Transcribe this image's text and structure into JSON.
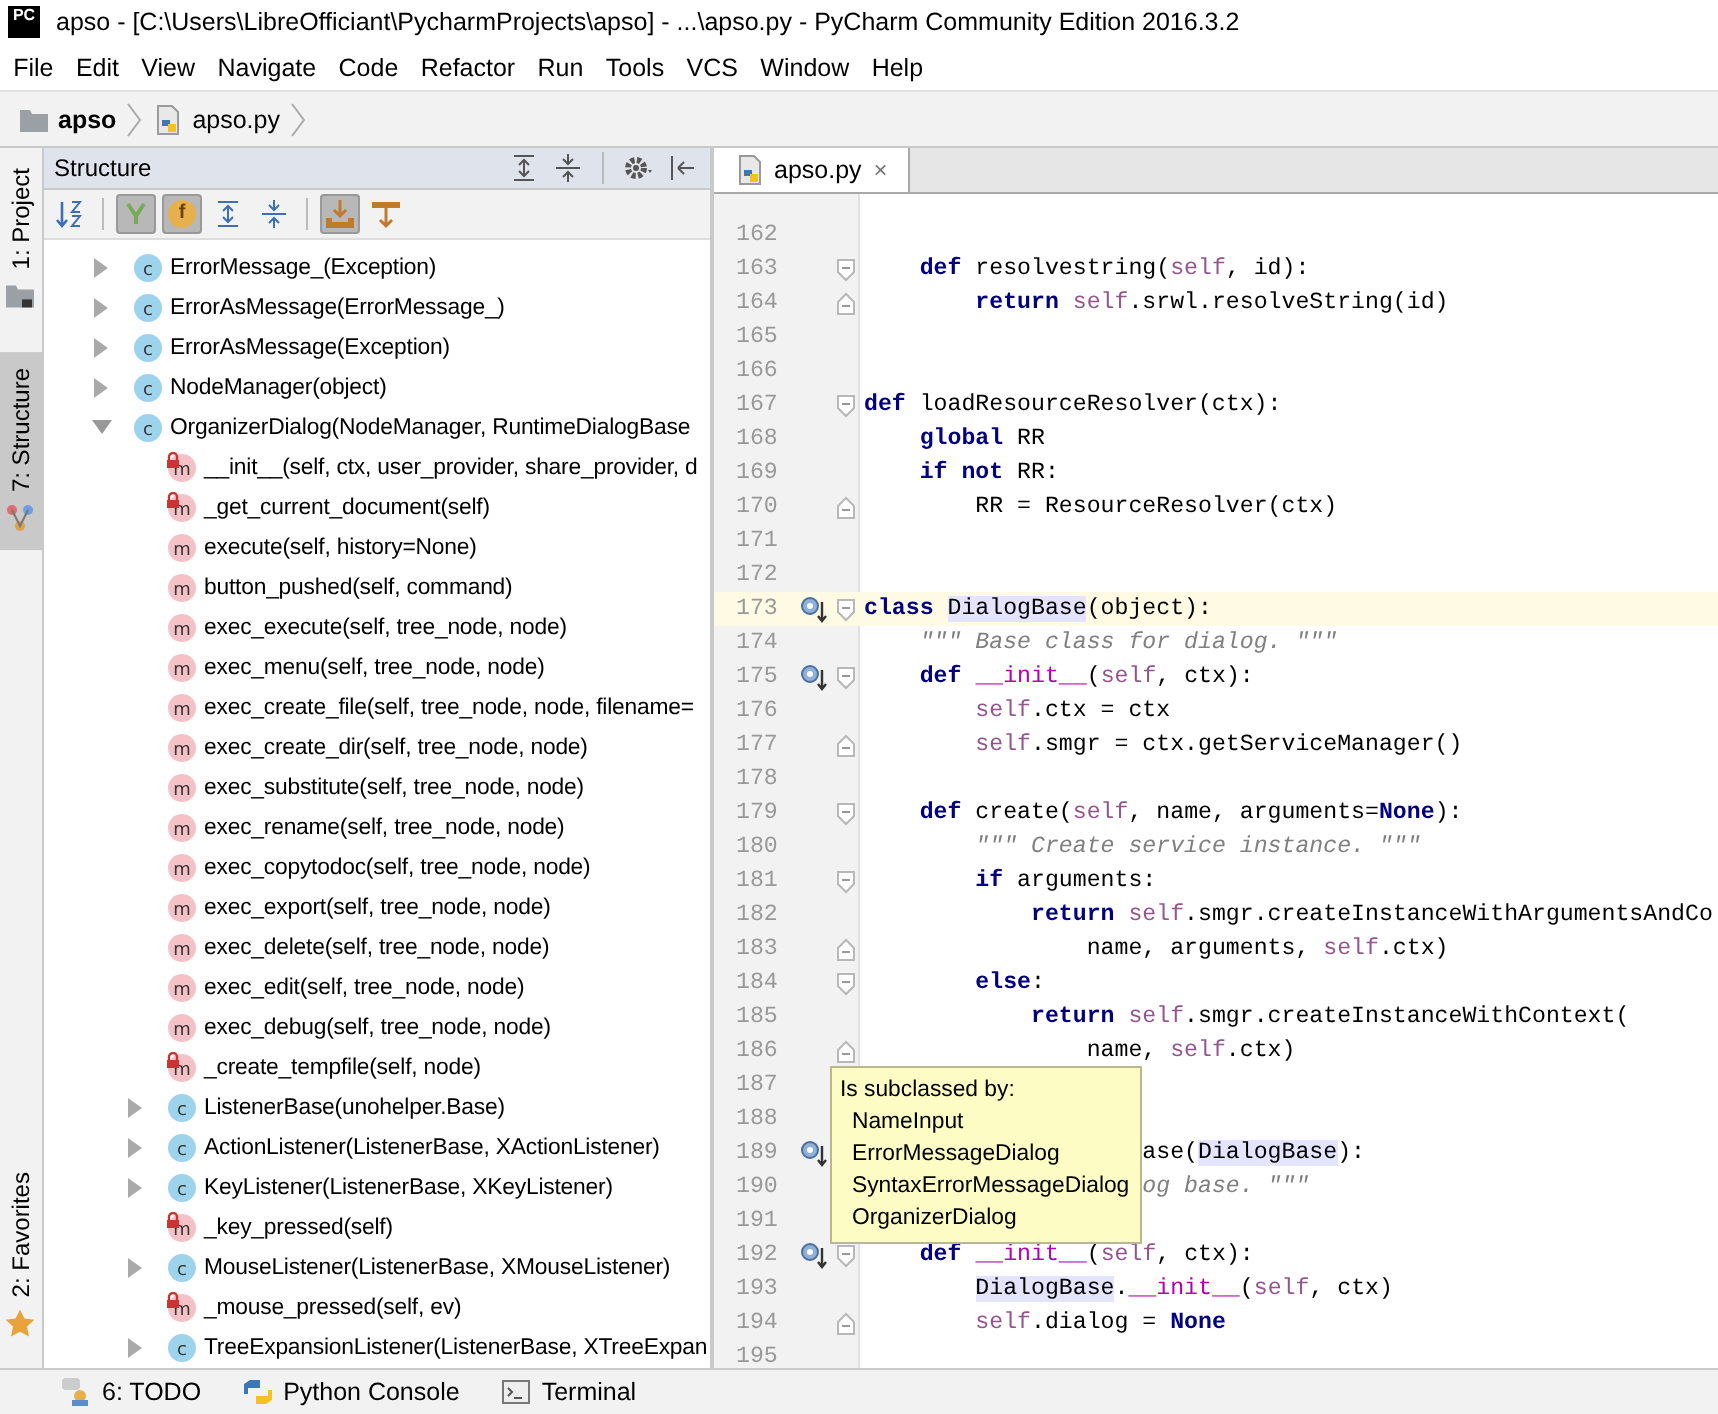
{
  "window": {
    "logo": "PC",
    "title": "apso - [C:\\Users\\LibreOfficiant\\PycharmProjects\\apso] - ...\\apso.py - PyCharm Community Edition 2016.3.2"
  },
  "menu": [
    {
      "label": "File"
    },
    {
      "label": "Edit"
    },
    {
      "label": "View"
    },
    {
      "label": "Navigate"
    },
    {
      "label": "Code"
    },
    {
      "label": "Refactor"
    },
    {
      "label": "Run"
    },
    {
      "label": "Tools"
    },
    {
      "label": "VCS"
    },
    {
      "label": "Window"
    },
    {
      "label": "Help"
    }
  ],
  "breadcrumb": [
    {
      "label": "apso",
      "kind": "folder"
    },
    {
      "label": "apso.py",
      "kind": "python"
    }
  ],
  "left_stripe": [
    {
      "label": "1: Project",
      "kind": "project",
      "selected": false
    },
    {
      "label": "7: Structure",
      "kind": "structure",
      "selected": true
    },
    {
      "label": "2: Favorites",
      "kind": "favorites",
      "selected": false
    }
  ],
  "structure": {
    "title": "Structure",
    "header_tools": [
      {
        "kind": "expand-all"
      },
      {
        "kind": "collapse-all"
      },
      {
        "kind": "separator"
      },
      {
        "kind": "gear"
      },
      {
        "kind": "hide"
      }
    ],
    "toolbar": [
      {
        "kind": "sort",
        "pressed": false
      },
      {
        "kind": "separator"
      },
      {
        "kind": "inherited",
        "pressed": true
      },
      {
        "kind": "fields",
        "pressed": true,
        "letter": "f"
      },
      {
        "kind": "expand",
        "pressed": false
      },
      {
        "kind": "collapse",
        "pressed": false
      },
      {
        "kind": "separator"
      },
      {
        "kind": "autoscroll-to",
        "pressed": true
      },
      {
        "kind": "autoscroll-from",
        "pressed": false
      }
    ],
    "tree": [
      {
        "label": "ErrorMessage_(Exception)",
        "kind": "class",
        "letter": "c",
        "expanded": false
      },
      {
        "label": "ErrorAsMessage(ErrorMessage_)",
        "kind": "class",
        "letter": "c",
        "expanded": false
      },
      {
        "label": "ErrorAsMessage(Exception)",
        "kind": "class",
        "letter": "c",
        "expanded": false
      },
      {
        "label": "NodeManager(object)",
        "kind": "class",
        "letter": "c",
        "expanded": false
      },
      {
        "label": "OrganizerDialog(NodeManager, RuntimeDialogBase",
        "kind": "class",
        "letter": "c",
        "expanded": true,
        "children": [
          {
            "label": "__init__(self, ctx, user_provider, share_provider, d",
            "kind": "method",
            "letter": "m",
            "private": true
          },
          {
            "label": "_get_current_document(self)",
            "kind": "method",
            "letter": "m",
            "private": true
          },
          {
            "label": "execute(self, history=None)",
            "kind": "method",
            "letter": "m",
            "private": false
          },
          {
            "label": "button_pushed(self, command)",
            "kind": "method",
            "letter": "m",
            "private": false
          },
          {
            "label": "exec_execute(self, tree_node, node)",
            "kind": "method",
            "letter": "m",
            "private": false
          },
          {
            "label": "exec_menu(self, tree_node, node)",
            "kind": "method",
            "letter": "m",
            "private": false
          },
          {
            "label": "exec_create_file(self, tree_node, node, filename=",
            "kind": "method",
            "letter": "m",
            "private": false
          },
          {
            "label": "exec_create_dir(self, tree_node, node)",
            "kind": "method",
            "letter": "m",
            "private": false
          },
          {
            "label": "exec_substitute(self, tree_node, node)",
            "kind": "method",
            "letter": "m",
            "private": false
          },
          {
            "label": "exec_rename(self, tree_node, node)",
            "kind": "method",
            "letter": "m",
            "private": false
          },
          {
            "label": "exec_copytodoc(self, tree_node, node)",
            "kind": "method",
            "letter": "m",
            "private": false
          },
          {
            "label": "exec_export(self, tree_node, node)",
            "kind": "method",
            "letter": "m",
            "private": false
          },
          {
            "label": "exec_delete(self, tree_node, node)",
            "kind": "method",
            "letter": "m",
            "private": false
          },
          {
            "label": "exec_edit(self, tree_node, node)",
            "kind": "method",
            "letter": "m",
            "private": false
          },
          {
            "label": "exec_debug(self, tree_node, node)",
            "kind": "method",
            "letter": "m",
            "private": false
          },
          {
            "label": "_create_tempfile(self, node)",
            "kind": "method",
            "letter": "m",
            "private": true
          },
          {
            "label": "ListenerBase(unohelper.Base)",
            "kind": "class",
            "letter": "c",
            "expanded": false
          },
          {
            "label": "ActionListener(ListenerBase, XActionListener)",
            "kind": "class",
            "letter": "c",
            "expanded": false
          },
          {
            "label": "KeyListener(ListenerBase, XKeyListener)",
            "kind": "class",
            "letter": "c",
            "expanded": false
          },
          {
            "label": "_key_pressed(self)",
            "kind": "method",
            "letter": "m",
            "private": true
          },
          {
            "label": "MouseListener(ListenerBase, XMouseListener)",
            "kind": "class",
            "letter": "c",
            "expanded": false
          },
          {
            "label": "_mouse_pressed(self, ev)",
            "kind": "method",
            "letter": "m",
            "private": true
          },
          {
            "label": "TreeExpansionListener(ListenerBase, XTreeExpan",
            "kind": "class",
            "letter": "c",
            "expanded": false
          }
        ]
      }
    ]
  },
  "editor": {
    "tab": {
      "label": "apso.py",
      "close": "×",
      "selected": true
    },
    "lines": [
      {
        "number": "162",
        "current": false
      },
      {
        "number": "163",
        "current": false,
        "fold_open": true,
        "code": [
          {
            "text": "    def",
            "kind": "keyword"
          },
          {
            "text": " resolvestring(",
            "kind": "plain"
          },
          {
            "text": "self",
            "kind": "self"
          },
          {
            "text": ", id):",
            "kind": "plain"
          }
        ]
      },
      {
        "number": "164",
        "current": false,
        "fold_close": true,
        "code": [
          {
            "text": "        return ",
            "kind": "keyword"
          },
          {
            "text": "self",
            "kind": "self"
          },
          {
            "text": ".srwl.resolveString(id)",
            "kind": "plain"
          }
        ]
      },
      {
        "number": "165",
        "current": false
      },
      {
        "number": "166",
        "current": false
      },
      {
        "number": "167",
        "current": false,
        "fold_open": true,
        "code": [
          {
            "text": "def",
            "kind": "keyword"
          },
          {
            "text": " loadResourceResolver(ctx):",
            "kind": "plain"
          }
        ]
      },
      {
        "number": "168",
        "current": false,
        "code": [
          {
            "text": "    global",
            "kind": "keyword"
          },
          {
            "text": " RR",
            "kind": "plain"
          }
        ]
      },
      {
        "number": "169",
        "current": false,
        "code": [
          {
            "text": "    if not",
            "kind": "keyword"
          },
          {
            "text": " RR:",
            "kind": "plain"
          }
        ]
      },
      {
        "number": "170",
        "current": false,
        "fold_close": true,
        "code": [
          {
            "text": "        RR = ResourceResolver(ctx)",
            "kind": "plain"
          }
        ]
      },
      {
        "number": "171",
        "current": false
      },
      {
        "number": "172",
        "current": false
      },
      {
        "number": "173",
        "current": true,
        "marker": true,
        "fold_open": true,
        "code": [
          {
            "text": "class ",
            "kind": "keyword"
          },
          {
            "text": "DialogBase",
            "kind": "reference"
          },
          {
            "text": "(object):",
            "kind": "plain"
          }
        ]
      },
      {
        "number": "174",
        "current": false,
        "code": [
          {
            "text": "    \"\"\" Base class for dialog. \"\"\"",
            "kind": "docstring"
          }
        ]
      },
      {
        "number": "175",
        "current": false,
        "marker": true,
        "fold_open": true,
        "code": [
          {
            "text": "    def ",
            "kind": "keyword"
          },
          {
            "text": "__init__",
            "kind": "magic"
          },
          {
            "text": "(",
            "kind": "plain"
          },
          {
            "text": "self",
            "kind": "self"
          },
          {
            "text": ", ctx):",
            "kind": "plain"
          }
        ]
      },
      {
        "number": "176",
        "current": false,
        "code": [
          {
            "text": "        self",
            "kind": "self"
          },
          {
            "text": ".ctx = ctx",
            "kind": "plain"
          }
        ]
      },
      {
        "number": "177",
        "current": false,
        "fold_close": true,
        "code": [
          {
            "text": "        self",
            "kind": "self"
          },
          {
            "text": ".smgr = ctx.getServiceManager()",
            "kind": "plain"
          }
        ]
      },
      {
        "number": "178",
        "current": false
      },
      {
        "number": "179",
        "current": false,
        "fold_open": true,
        "code": [
          {
            "text": "    def",
            "kind": "keyword"
          },
          {
            "text": " create(",
            "kind": "plain"
          },
          {
            "text": "self",
            "kind": "self"
          },
          {
            "text": ", name, arguments=",
            "kind": "plain"
          },
          {
            "text": "None",
            "kind": "constant"
          },
          {
            "text": "):",
            "kind": "plain"
          }
        ]
      },
      {
        "number": "180",
        "current": false,
        "code": [
          {
            "text": "        \"\"\" Create service instance. \"\"\"",
            "kind": "docstring"
          }
        ]
      },
      {
        "number": "181",
        "current": false,
        "fold_open": true,
        "code": [
          {
            "text": "        if",
            "kind": "keyword"
          },
          {
            "text": " arguments:",
            "kind": "plain"
          }
        ]
      },
      {
        "number": "182",
        "current": false,
        "code": [
          {
            "text": "            return ",
            "kind": "keyword"
          },
          {
            "text": "self",
            "kind": "self"
          },
          {
            "text": ".smgr.createInstanceWithArgumentsAndCo",
            "kind": "plain"
          }
        ]
      },
      {
        "number": "183",
        "current": false,
        "fold_close": true,
        "code": [
          {
            "text": "                name, arguments, ",
            "kind": "plain"
          },
          {
            "text": "self",
            "kind": "self"
          },
          {
            "text": ".ctx)",
            "kind": "plain"
          }
        ]
      },
      {
        "number": "184",
        "current": false,
        "fold_open": true,
        "code": [
          {
            "text": "        else",
            "kind": "keyword"
          },
          {
            "text": ":",
            "kind": "plain"
          }
        ]
      },
      {
        "number": "185",
        "current": false,
        "code": [
          {
            "text": "            return ",
            "kind": "keyword"
          },
          {
            "text": "self",
            "kind": "self"
          },
          {
            "text": ".smgr.createInstanceWithContext(",
            "kind": "plain"
          }
        ]
      },
      {
        "number": "186",
        "current": false,
        "fold_close": true,
        "code": [
          {
            "text": "                name, ",
            "kind": "plain"
          },
          {
            "text": "self",
            "kind": "self"
          },
          {
            "text": ".ctx)",
            "kind": "plain"
          }
        ]
      },
      {
        "number": "187",
        "current": false
      },
      {
        "number": "188",
        "current": false
      },
      {
        "number": "189",
        "current": false,
        "marker": true,
        "code": [
          {
            "text": "                    ase(",
            "kind": "plain"
          },
          {
            "text": "DialogBase",
            "kind": "reference"
          },
          {
            "text": "):",
            "kind": "plain"
          }
        ]
      },
      {
        "number": "190",
        "current": false,
        "code": [
          {
            "text": "                    og base. \"\"\"",
            "kind": "docstring"
          }
        ]
      },
      {
        "number": "191",
        "current": false
      },
      {
        "number": "192",
        "current": false,
        "marker": true,
        "fold_open": true,
        "code": [
          {
            "text": "    def ",
            "kind": "keyword"
          },
          {
            "text": "__init__",
            "kind": "magic"
          },
          {
            "text": "(",
            "kind": "plain"
          },
          {
            "text": "self",
            "kind": "self"
          },
          {
            "text": ", ctx):",
            "kind": "plain"
          }
        ]
      },
      {
        "number": "193",
        "current": false,
        "code": [
          {
            "text": "        DialogBase",
            "kind": "reference"
          },
          {
            "text": ".",
            "kind": "plain"
          },
          {
            "text": "__init__",
            "kind": "magic"
          },
          {
            "text": "(",
            "kind": "plain"
          },
          {
            "text": "self",
            "kind": "self"
          },
          {
            "text": ", ctx)",
            "kind": "plain"
          }
        ]
      },
      {
        "number": "194",
        "current": false,
        "fold_close": true,
        "code": [
          {
            "text": "        self",
            "kind": "self"
          },
          {
            "text": ".dialog = ",
            "kind": "plain"
          },
          {
            "text": "None",
            "kind": "constant"
          }
        ]
      },
      {
        "number": "195",
        "current": false
      }
    ],
    "tooltip": {
      "title": "Is subclassed by:",
      "items": [
        "NameInput",
        "ErrorMessageDialog",
        "SyntaxErrorMessageDialog",
        "OrganizerDialog"
      ]
    }
  },
  "bottom_bar": [
    {
      "label": "6: TODO",
      "kind": "todo"
    },
    {
      "label": "Python Console",
      "kind": "python"
    },
    {
      "label": "Terminal",
      "kind": "terminal"
    }
  ]
}
